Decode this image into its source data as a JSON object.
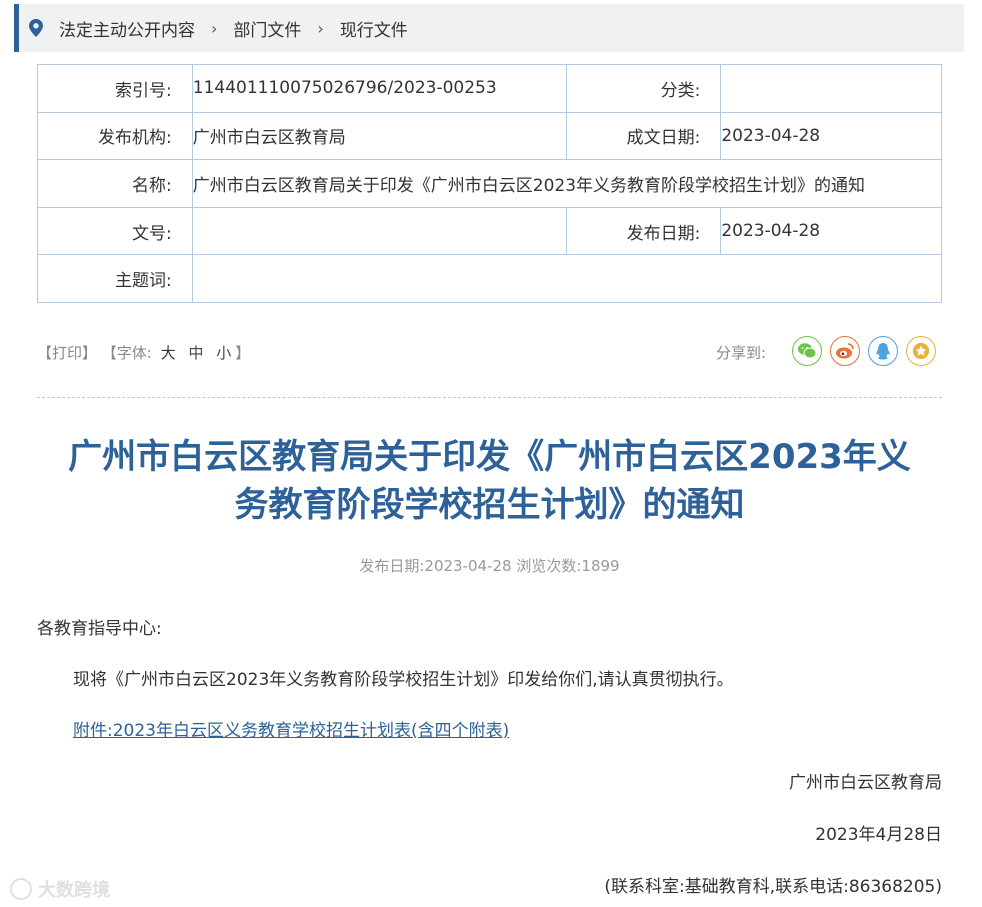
{
  "breadcrumb": {
    "items": [
      "法定主动公开内容",
      "部门文件",
      "现行文件"
    ]
  },
  "meta": {
    "index_label": "索引号:",
    "index_value": "114401110075026796/2023-00253",
    "category_label": "分类:",
    "category_value": "",
    "publisher_label": "发布机构:",
    "publisher_value": "广州市白云区教育局",
    "written_date_label": "成文日期:",
    "written_date_value": "2023-04-28",
    "name_label": "名称:",
    "name_value": "广州市白云区教育局关于印发《广州市白云区2023年义务教育阶段学校招生计划》的通知",
    "doc_no_label": "文号:",
    "doc_no_value": "",
    "pub_date_label": "发布日期:",
    "pub_date_value": "2023-04-28",
    "keywords_label": "主题词:",
    "keywords_value": ""
  },
  "tools": {
    "print": "【打印】",
    "font_prefix": "【字体:",
    "font_large": "大",
    "font_medium": "中",
    "font_small": "小",
    "font_suffix": "】",
    "share_label": "分享到:"
  },
  "share_icons": [
    "wechat-icon",
    "weibo-icon",
    "qq-icon",
    "favorite-icon"
  ],
  "colors": {
    "accent": "#2c6199",
    "border": "#b3cbe0",
    "wechat": "#6cc24a",
    "weibo": "#e8733a",
    "qq": "#4aa3e0",
    "fav": "#e9b03a"
  },
  "article": {
    "title_line1": "广州市白云区教育局关于印发《广州市白云区2023年义",
    "title_line2": "务教育阶段学校招生计划》的通知",
    "pub_info": "发布日期:2023-04-28  浏览次数:1899",
    "salutation": "各教育指导中心:",
    "paragraph": "现将《广州市白云区2023年义务教育阶段学校招生计划》印发给你们,请认真贯彻执行。",
    "attachment": "附件:2023年白云区义务教育学校招生计划表(含四个附表)",
    "sign_org": "广州市白云区教育局",
    "sign_date": "2023年4月28日",
    "contact": "(联系科室:基础教育科,联系电话:86368205)"
  },
  "watermark": "大数跨境"
}
